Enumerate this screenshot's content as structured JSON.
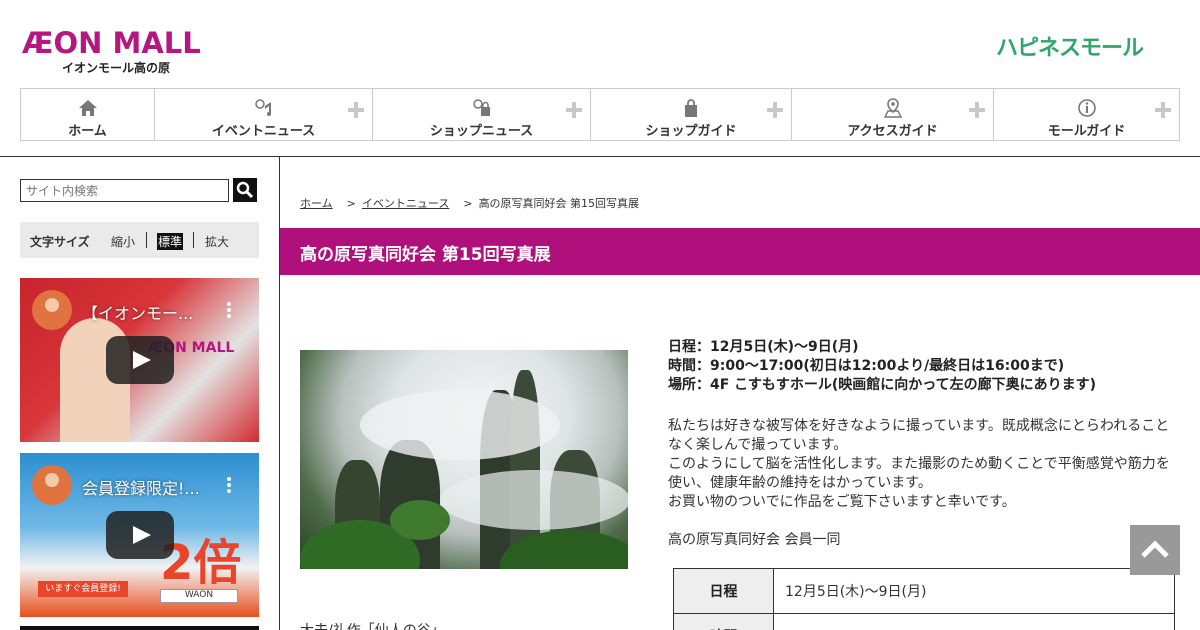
{
  "header": {
    "logo_main": "ÆON MALL",
    "logo_sub": "イオンモール高の原",
    "happiness_logo": "ハピネスモール"
  },
  "nav": {
    "items": [
      {
        "label": "ホーム",
        "icon": "home-icon"
      },
      {
        "label": "イベントニュース",
        "icon": "event-icon"
      },
      {
        "label": "ショップニュース",
        "icon": "shop-news-icon"
      },
      {
        "label": "ショップガイド",
        "icon": "shopping-bag-icon"
      },
      {
        "label": "アクセスガイド",
        "icon": "map-pin-icon"
      },
      {
        "label": "モールガイド",
        "icon": "info-icon"
      }
    ]
  },
  "sidebar": {
    "search_placeholder": "サイト内検索",
    "font_size": {
      "label": "文字サイズ",
      "small": "縮小",
      "normal": "標準",
      "large": "拡大"
    },
    "videos": [
      {
        "title": "【イオンモー..."
      },
      {
        "title": "会員登録限定!..."
      }
    ],
    "video1_brand": "ÆON MALL",
    "video2_big": "2倍",
    "video2_waon": "WAON",
    "video2_cta": "いますぐ会員登録!"
  },
  "breadcrumb": {
    "home": "ホーム",
    "events": "イベントニュース",
    "current": "高の原写真同好会 第15回写真展",
    "sep": ">"
  },
  "page_title": "高の原写真同好会 第15回写真展",
  "event": {
    "date_line": "日程：12月5日(木)～9日(月)",
    "time_line": "時間：9:00～17:00(初日は12:00より/最終日は16:00まで)",
    "place_line": "場所：4F こすもすホール(映画館に向かって左の廊下奥にあります)",
    "desc": [
      "私たちは好きな被写体を好きなように撮っています。既成概念にとらわれること",
      "なく楽しんで撮っています。",
      "このようにして脳を活性化します。また撮影のため動くことで平衡感覚や筋力を",
      "使い、健康年齢の維持をはかっています。",
      "お買い物のついでに作品をご覧下さいますと幸いです。"
    ],
    "signature": "高の原写真同好会 会員一同",
    "photo_caption": "大夫/礼作「仙人の谷」"
  },
  "schedule_table": {
    "rows": [
      {
        "label": "日程",
        "value": "12月5日(木)～9日(月)"
      },
      {
        "label": "時間",
        "value": ""
      }
    ]
  },
  "colors": {
    "brand_magenta": "#b0107c",
    "happiness_green": "#2fa66a"
  }
}
